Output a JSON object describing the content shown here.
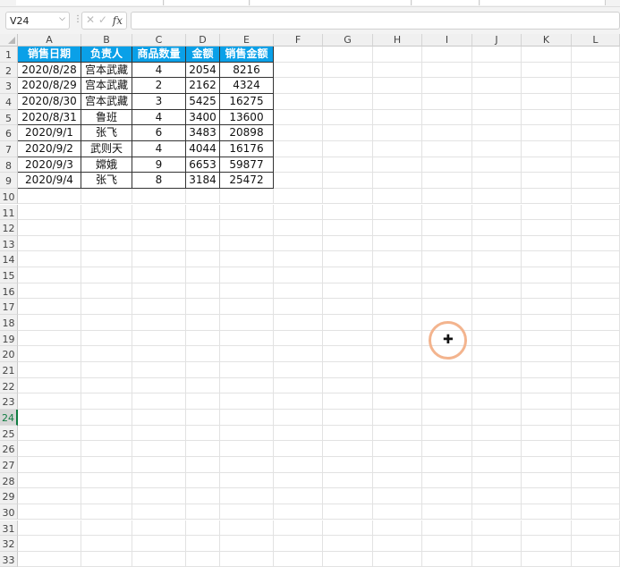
{
  "formula_bar": {
    "name_box": "V24",
    "cancel_icon": "✕",
    "enter_icon": "✓",
    "fx_label": "fx",
    "formula": ""
  },
  "columns": [
    "A",
    "B",
    "C",
    "D",
    "E",
    "F",
    "G",
    "H",
    "I",
    "J",
    "K",
    "L"
  ],
  "row_count": 33,
  "selected_row": 24,
  "colors": {
    "header_fill": "#0aa0e8",
    "header_text": "#ffffff",
    "cursor_ring": "#f3b48e"
  },
  "table": {
    "headers": [
      "销售日期",
      "负责人",
      "商品数量",
      "金额",
      "销售金额"
    ],
    "rows": [
      [
        "2020/8/28",
        "宫本武藏",
        "4",
        "2054",
        "8216"
      ],
      [
        "2020/8/29",
        "宫本武藏",
        "2",
        "2162",
        "4324"
      ],
      [
        "2020/8/30",
        "宫本武藏",
        "3",
        "5425",
        "16275"
      ],
      [
        "2020/8/31",
        "鲁班",
        "4",
        "3400",
        "13600"
      ],
      [
        "2020/9/1",
        "张飞",
        "6",
        "3483",
        "20898"
      ],
      [
        "2020/9/2",
        "武则天",
        "4",
        "4044",
        "16176"
      ],
      [
        "2020/9/3",
        "嫦娥",
        "9",
        "6653",
        "59877"
      ],
      [
        "2020/9/4",
        "张飞",
        "8",
        "3184",
        "25472"
      ]
    ]
  }
}
